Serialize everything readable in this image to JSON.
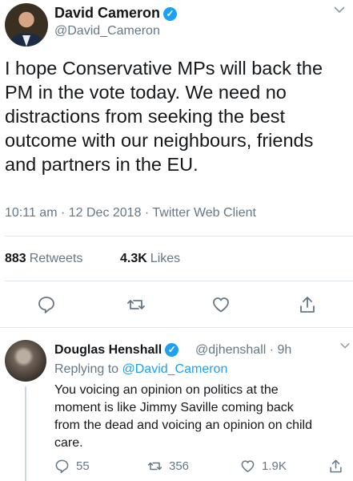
{
  "tweet": {
    "author_name": "David Cameron",
    "author_handle": "@David_Cameron",
    "text": "I hope Conservative MPs will back the\nPM in the vote today.  We need no\ndistractions from seeking the best\noutcome with our neighbours, friends\nand partners in the EU.",
    "timestamp": "10:11 am · 12 Dec 2018 · Twitter Web Client",
    "retweets_count": "883",
    "retweets_label": "Retweets",
    "likes_count": "4.3K",
    "likes_label": "Likes"
  },
  "reply": {
    "author_name": "Douglas Henshall",
    "author_handle": "@djhenshall · 9h",
    "replying_prefix": "Replying to",
    "replying_to": "@David_Cameron",
    "text": "You voicing an opinion on politics at the\nmoment is like Jimmy Saville coming back\nfrom the dead and  voicing an opinion on child\ncare.",
    "reply_count": "55",
    "retweet_count": "356",
    "like_count": "1.9K"
  },
  "icons": {
    "verified": "verified-badge-icon",
    "more": "chevron-down-icon",
    "reply": "reply-icon",
    "retweet": "retweet-icon",
    "like": "heart-icon",
    "share": "share-icon"
  },
  "colors": {
    "accent": "#1da1f2",
    "secondary_text": "#657786",
    "primary_text": "#14171a",
    "divider": "#e1e8ed"
  }
}
